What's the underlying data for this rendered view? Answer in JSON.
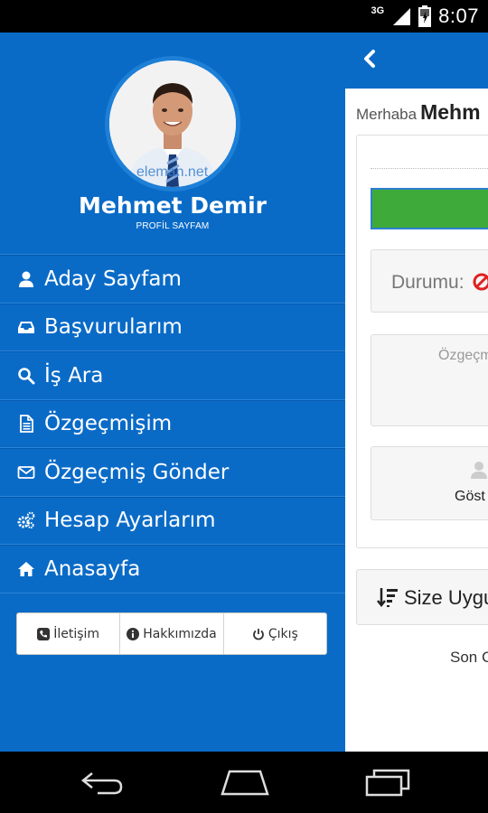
{
  "status_bar": {
    "network": "3G",
    "time": "8:07"
  },
  "drawer": {
    "user_name": "Mehmet Demir",
    "profile_label": "PROFİL SAYFAM",
    "avatar_watermark": "eleman.net",
    "menu": [
      {
        "label": "Aday Sayfam",
        "icon": "user-icon"
      },
      {
        "label": "Başvurularım",
        "icon": "inbox-icon"
      },
      {
        "label": "İş Ara",
        "icon": "search-icon"
      },
      {
        "label": "Özgeçmişim",
        "icon": "document-icon"
      },
      {
        "label": "Özgeçmiş Gönder",
        "icon": "envelope-icon"
      },
      {
        "label": "Hesap Ayarlarım",
        "icon": "gears-icon"
      },
      {
        "label": "Anasayfa",
        "icon": "home-icon"
      }
    ],
    "footer": {
      "contact": "İletişim",
      "about": "Hakkımızda",
      "logout": "Çıkış"
    }
  },
  "content": {
    "greeting_prefix": "Merhaba",
    "greeting_name": "Mehm",
    "status_label": "Durumu:",
    "cv_label": "Özgeçm",
    "show_label": "Göst",
    "sort_label": "Size Uygu",
    "last_label": "Son C"
  },
  "colors": {
    "primary": "#0a6bc7",
    "green": "#3eaa3a"
  }
}
